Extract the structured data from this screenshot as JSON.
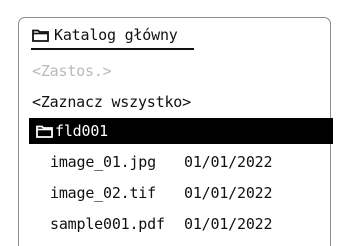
{
  "header": {
    "title": "Katalog główny",
    "icon": "folder-icon"
  },
  "menu": {
    "apply_label": "<Zastos.>",
    "select_all_label": "<Zaznacz wszystko>"
  },
  "folder": {
    "name": "fld001",
    "icon": "folder-icon"
  },
  "files": [
    {
      "name": "image_01.jpg",
      "date": "01/01/2022"
    },
    {
      "name": "image_02.tif",
      "date": "01/01/2022"
    },
    {
      "name": "sample001.pdf",
      "date": "01/01/2022"
    }
  ],
  "colors": {
    "text": "#111111",
    "disabled": "#b9b9b9",
    "highlight_bg": "#000000",
    "highlight_text": "#ffffff"
  }
}
